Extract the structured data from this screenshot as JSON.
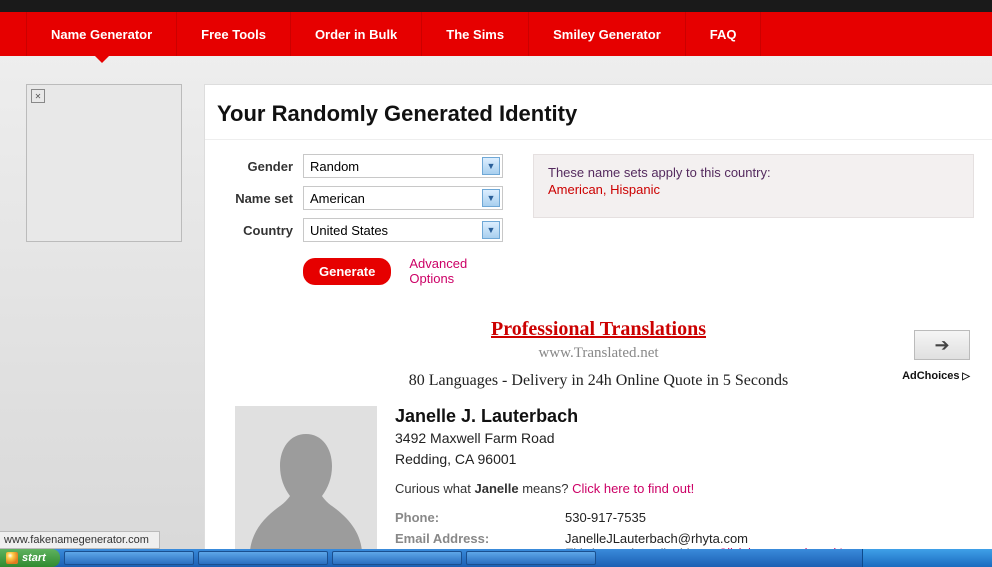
{
  "nav": [
    "Name Generator",
    "Free Tools",
    "Order in Bulk",
    "The Sims",
    "Smiley Generator",
    "FAQ"
  ],
  "heading": "Your Randomly Generated Identity",
  "form": {
    "gender": {
      "label": "Gender",
      "value": "Random"
    },
    "nameset": {
      "label": "Name set",
      "value": "American"
    },
    "country": {
      "label": "Country",
      "value": "United States"
    },
    "generate": "Generate",
    "advanced": "Advanced Options"
  },
  "namesets": {
    "intro": "These name sets apply to this country:",
    "list": "American, Hispanic"
  },
  "ad": {
    "title": "Professional Translations",
    "url": "www.Translated.net",
    "desc": "80 Languages - Delivery in 24h Online Quote in 5 Seconds",
    "choices": "AdChoices"
  },
  "identity": {
    "name": "Janelle J. Lauterbach",
    "addr1": "3492 Maxwell Farm Road",
    "addr2": "Redding, CA 96001",
    "curious_pre": "Curious what ",
    "curious_name": "Janelle",
    "curious_post": " means? ",
    "curious_link": "Click here to find out!",
    "phone_label": "Phone:",
    "phone": "530-917-7535",
    "email_label": "Email Address:",
    "email": "JanelleJLauterbach@rhyta.com",
    "email_note_pre": "This is a real email address. ",
    "email_note_link": "Click here to activate it!"
  },
  "status": "www.fakenamegenerator.com",
  "start": "start"
}
